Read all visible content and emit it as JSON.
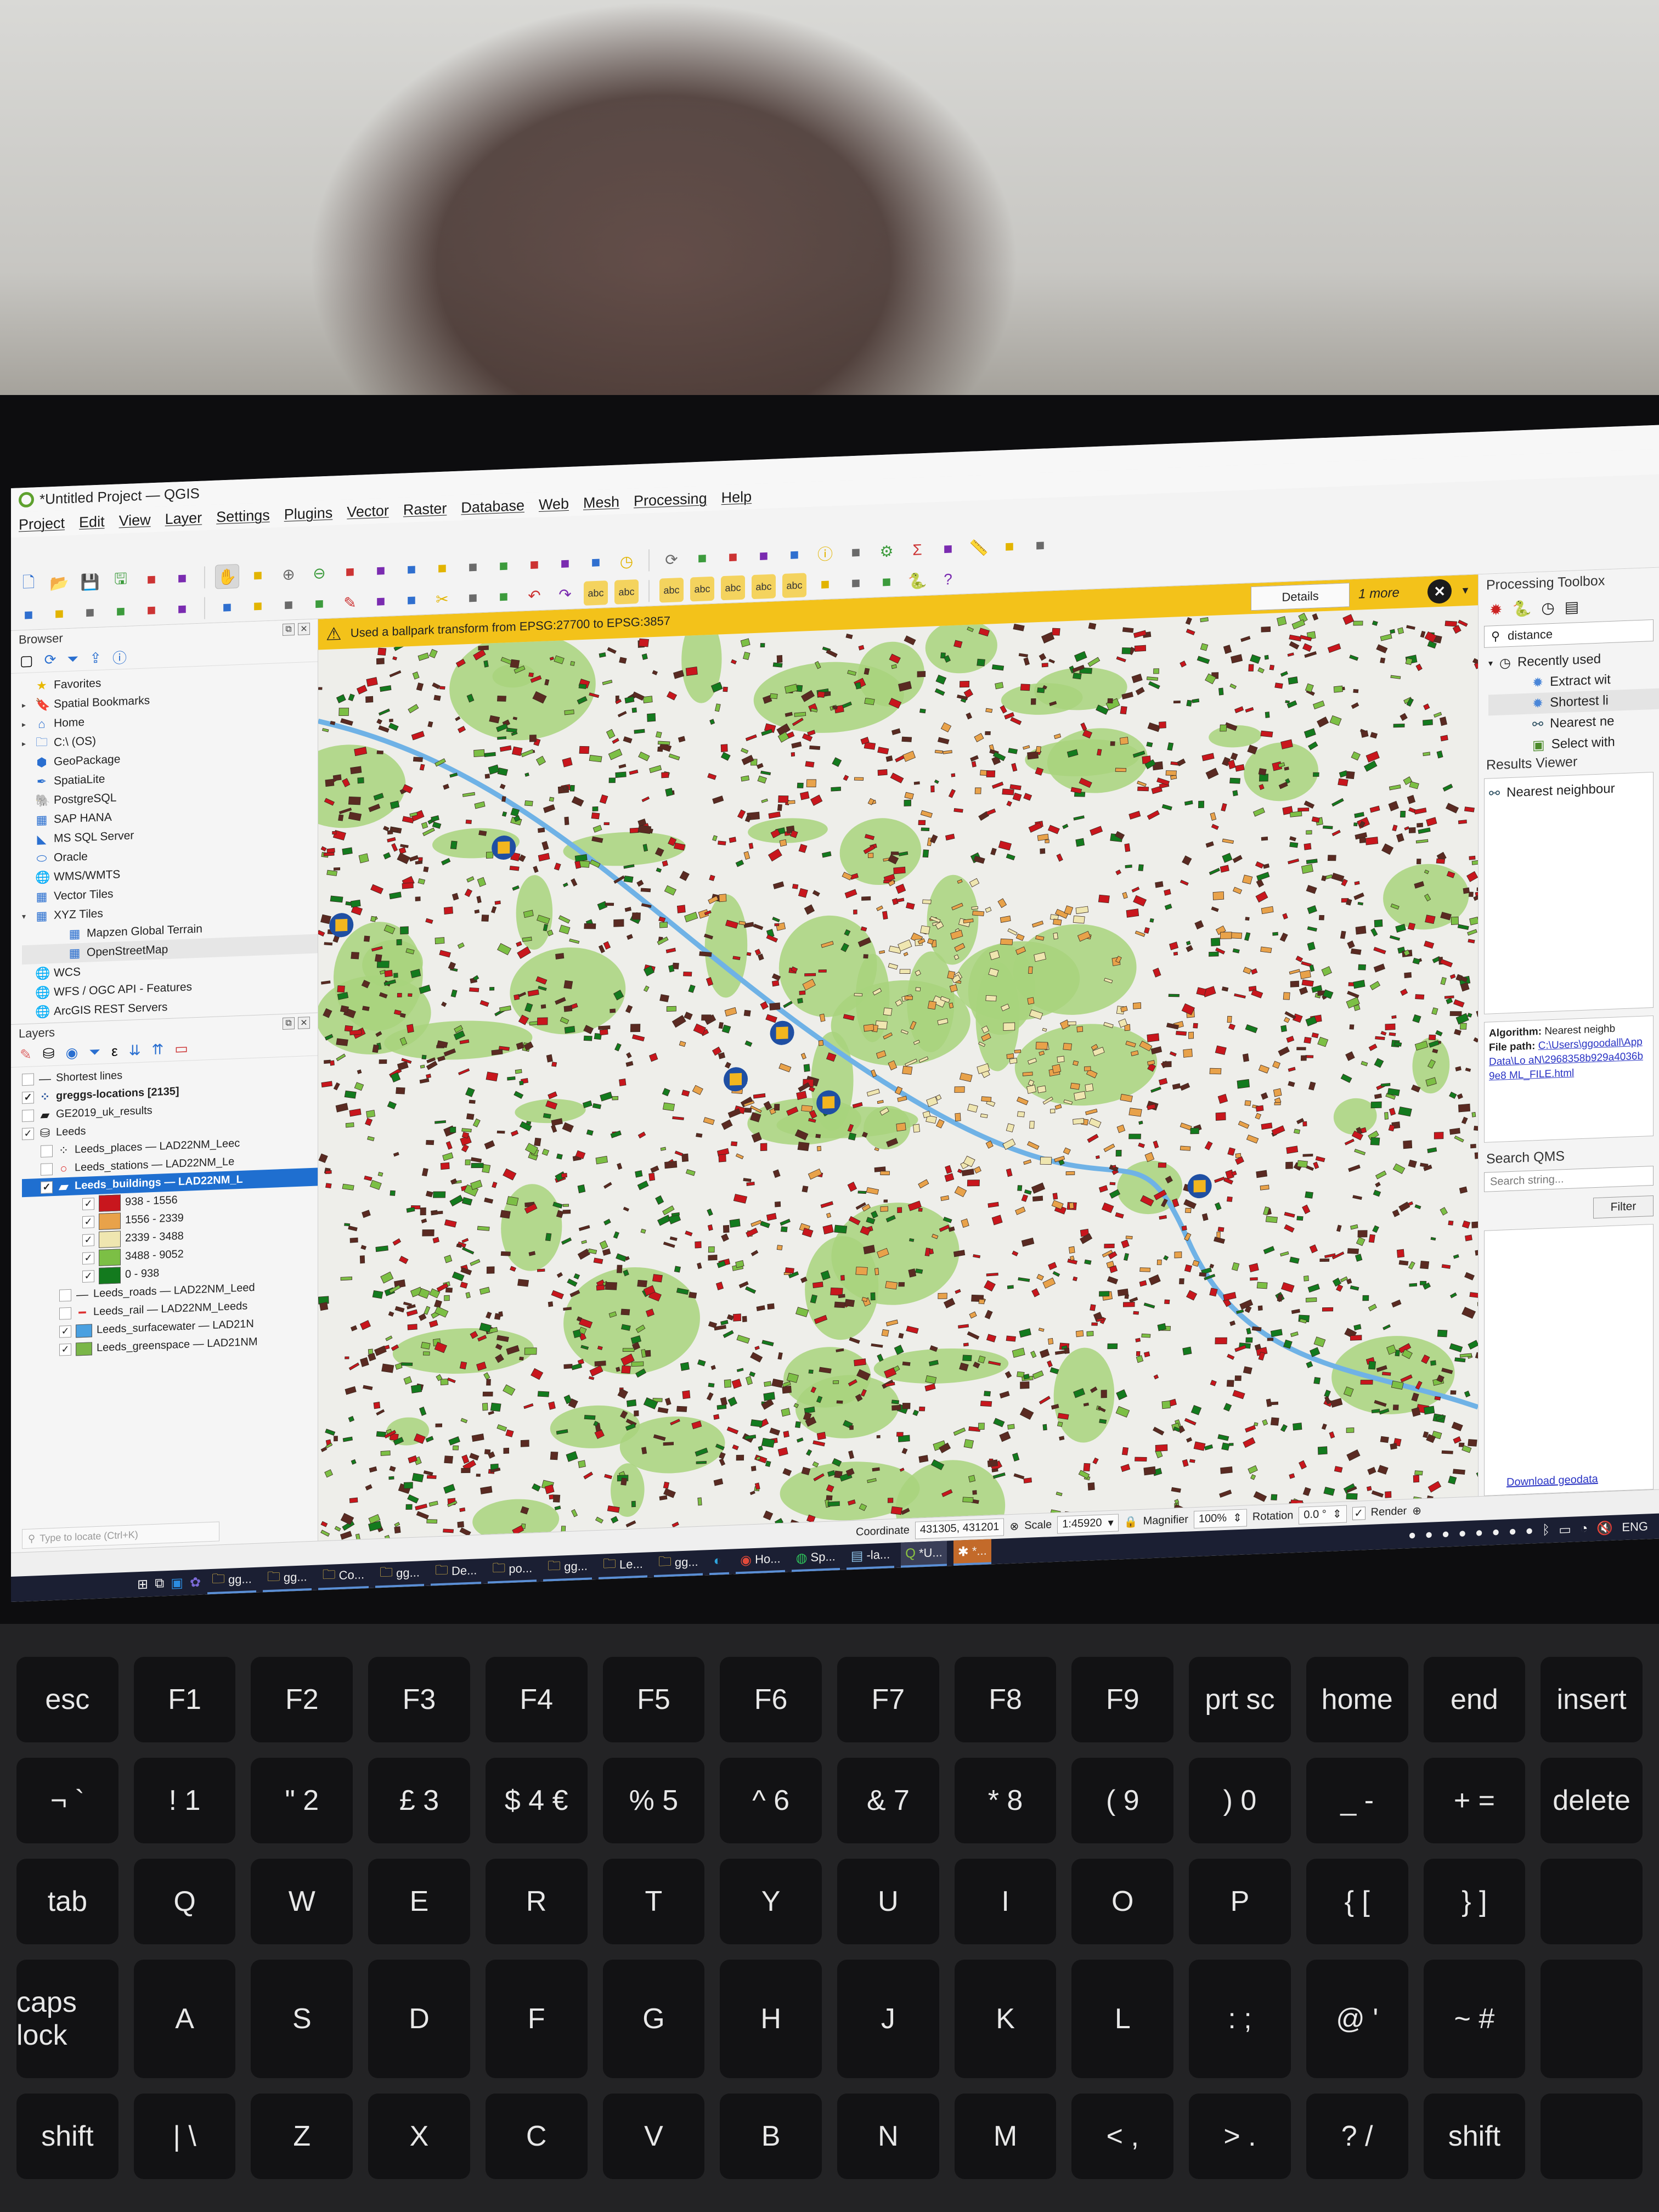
{
  "window": {
    "title": "*Untitled Project — QGIS"
  },
  "menubar": [
    "Project",
    "Edit",
    "View",
    "Layer",
    "Settings",
    "Plugins",
    "Vector",
    "Raster",
    "Database",
    "Web",
    "Mesh",
    "Processing",
    "Help"
  ],
  "toolbar_icons": {
    "row1": [
      "new-project-icon",
      "open-project-icon",
      "save-project-icon",
      "save-as-icon",
      "project-properties-icon",
      "style-manager-icon",
      "pan-icon",
      "pan-to-selection-icon",
      "zoom-in-icon",
      "zoom-out-icon",
      "zoom-full-icon",
      "zoom-to-selection-icon",
      "zoom-to-layer-icon",
      "zoom-native-icon",
      "zoom-last-icon",
      "zoom-next-icon",
      "new-bookmark-icon",
      "show-bookmarks-icon",
      "new-3d-view-icon",
      "temporal-controller-icon",
      "refresh-icon",
      "select-features-icon",
      "select-by-value-icon",
      "deselect-icon",
      "select-location-icon",
      "identify-icon",
      "open-attribute-table-icon",
      "toolbox-icon",
      "statistics-icon",
      "attribute-table-icon",
      "measure-icon",
      "map-tips-icon",
      "locate-icon"
    ],
    "row2": [
      "add-layer-icon",
      "geopackage-icon",
      "vector-layer-icon",
      "spatialite-icon",
      "virtual-layer-icon",
      "mesh-layer-icon",
      "new-shapefile-icon",
      "current-edits-icon",
      "toggle-editing-icon",
      "save-edits-icon",
      "digitize-icon",
      "vertex-tool-icon",
      "delete-selected-icon",
      "cut-icon",
      "copy-icon",
      "paste-icon",
      "undo-icon",
      "redo-icon",
      "label-icon",
      "diagram-icon",
      "pin-label-icon",
      "show-hide-labels-icon",
      "move-label-icon",
      "rotate-label-icon",
      "change-label-icon",
      "quickmapservices-icon",
      "search-qms-icon",
      "geocoder-icon",
      "python-console-icon",
      "help-icon"
    ]
  },
  "message_bar": {
    "text": "Used a ballpark transform from EPSG:27700 to EPSG:3857",
    "details_label": "Details",
    "more_label": "1 more"
  },
  "browser": {
    "title": "Browser",
    "items": [
      {
        "label": "Favorites",
        "icon": "star-icon",
        "arrow": ""
      },
      {
        "label": "Spatial Bookmarks",
        "icon": "bookmark-icon",
        "arrow": "▸"
      },
      {
        "label": "Home",
        "icon": "home-folder-icon",
        "arrow": "▸"
      },
      {
        "label": "C:\\ (OS)",
        "icon": "folder-icon",
        "arrow": "▸"
      },
      {
        "label": "GeoPackage",
        "icon": "geopackage-icon",
        "arrow": ""
      },
      {
        "label": "SpatiaLite",
        "icon": "spatialite-icon",
        "arrow": ""
      },
      {
        "label": "PostgreSQL",
        "icon": "postgresql-icon",
        "arrow": ""
      },
      {
        "label": "SAP HANA",
        "icon": "sap-hana-icon",
        "arrow": ""
      },
      {
        "label": "MS SQL Server",
        "icon": "mssql-icon",
        "arrow": ""
      },
      {
        "label": "Oracle",
        "icon": "oracle-icon",
        "arrow": ""
      },
      {
        "label": "WMS/WMTS",
        "icon": "globe-icon",
        "arrow": ""
      },
      {
        "label": "Vector Tiles",
        "icon": "grid-icon",
        "arrow": ""
      },
      {
        "label": "XYZ Tiles",
        "icon": "grid-icon",
        "arrow": "▾"
      },
      {
        "label": "Mapzen Global Terrain",
        "icon": "grid-icon",
        "arrow": "",
        "child": true
      },
      {
        "label": "OpenStreetMap",
        "icon": "grid-icon",
        "arrow": "",
        "child": true,
        "highlight": true
      },
      {
        "label": "WCS",
        "icon": "globe-icon",
        "arrow": ""
      },
      {
        "label": "WFS / OGC API - Features",
        "icon": "globe-icon",
        "arrow": ""
      },
      {
        "label": "ArcGIS REST Servers",
        "icon": "globe-icon",
        "arrow": ""
      }
    ]
  },
  "layers": {
    "title": "Layers",
    "items": [
      {
        "label": "Shortest lines",
        "checked": false,
        "icon": "line-layer-icon",
        "indent": 0
      },
      {
        "label": "greggs-locations [2135]",
        "checked": true,
        "icon": "point-layer-icon",
        "indent": 0,
        "bold": true
      },
      {
        "label": "GE2019_uk_results",
        "checked": false,
        "icon": "polygon-layer-icon",
        "indent": 0
      },
      {
        "label": "Leeds",
        "checked": true,
        "icon": "group-icon",
        "indent": 0
      },
      {
        "label": "Leeds_places — LAD22NM_Leec",
        "checked": false,
        "icon": "point-layer-icon",
        "indent": 1
      },
      {
        "label": "Leeds_stations — LAD22NM_Le",
        "checked": false,
        "icon": "station-icon",
        "indent": 1
      },
      {
        "label": "Leeds_buildings — LAD22NM_L",
        "checked": true,
        "icon": "polygon-layer-icon",
        "indent": 1,
        "selected": true
      }
    ],
    "legend": [
      {
        "label": "938 - 1556",
        "color": "#c8161d",
        "checked": true
      },
      {
        "label": "1556 - 2339",
        "color": "#e8a24a",
        "checked": true
      },
      {
        "label": "2339 - 3488",
        "color": "#efe6b0",
        "checked": true
      },
      {
        "label": "3488 - 9052",
        "color": "#7cbf45",
        "checked": true
      },
      {
        "label": "0 - 938",
        "color": "#137a1e",
        "checked": true
      }
    ],
    "more_items": [
      {
        "label": "Leeds_roads — LAD22NM_Leed",
        "checked": false,
        "icon": "line-layer-icon"
      },
      {
        "label": "Leeds_rail — LAD22NM_Leeds",
        "checked": false,
        "icon": "rail-line-icon"
      },
      {
        "label": "Leeds_surfacewater — LAD21N",
        "checked": true,
        "swatch": "#4aa0e0"
      },
      {
        "label": "Leeds_greenspace — LAD21NM",
        "checked": true,
        "swatch": "#7ab648"
      }
    ],
    "locator_placeholder": "Type to locate (Ctrl+K)"
  },
  "processing_toolbox": {
    "title": "Processing Toolbox",
    "search_value": "distance",
    "recent_label": "Recently used",
    "items": [
      "Extract wit",
      "Shortest li",
      "Nearest ne",
      "Select with"
    ]
  },
  "results_viewer": {
    "title": "Results Viewer",
    "items": [
      "Nearest neighbour"
    ]
  },
  "algorithm_info": {
    "algorithm_label": "Algorithm:",
    "algorithm_value": "Nearest neighb",
    "filepath_label": "File path:",
    "filepath_value": "C:\\Users\\ggoodall\\AppData\\Lo aN\\2968358b929a4036b9e8 ML_FILE.html"
  },
  "qms": {
    "title": "Search QMS",
    "placeholder": "Search string...",
    "filter_label": "Filter",
    "download_link": "Download geodata"
  },
  "statusbar": {
    "coordinate_label": "Coordinate",
    "coordinate_value": "431305, 431201",
    "scale_label": "Scale",
    "scale_value": "1:45920",
    "magnifier_label": "Magnifier",
    "magnifier_value": "100%",
    "rotation_label": "Rotation",
    "rotation_value": "0.0 °",
    "render_label": "Render",
    "render_checked": true
  },
  "taskbar": {
    "apps": [
      {
        "label": "gg...",
        "icon": "folder-icon"
      },
      {
        "label": "gg...",
        "icon": "folder-icon"
      },
      {
        "label": "Co...",
        "icon": "folder-icon"
      },
      {
        "label": "gg...",
        "icon": "folder-icon"
      },
      {
        "label": "De...",
        "icon": "folder-icon"
      },
      {
        "label": "po...",
        "icon": "folder-icon"
      },
      {
        "label": "gg...",
        "icon": "folder-icon"
      },
      {
        "label": "Le...",
        "icon": "folder-icon"
      },
      {
        "label": "gg...",
        "icon": "folder-icon"
      },
      {
        "label": "",
        "icon": "edge-icon"
      },
      {
        "label": "Ho...",
        "icon": "chrome-icon"
      },
      {
        "label": "Sp...",
        "icon": "spotify-icon"
      },
      {
        "label": "-la...",
        "icon": "notepad-icon"
      },
      {
        "label": "*U...",
        "icon": "qgis-icon",
        "active": true
      },
      {
        "label": "*...",
        "icon": "slack-icon",
        "orange": true
      }
    ],
    "tray_lang": "ENG"
  },
  "map": {
    "colors": {
      "background": "#eeeeea",
      "greenspace": "#a8d47c",
      "water": "#6fb2e6",
      "building_outline": "#3b2a20",
      "class_colors": [
        "#c8161d",
        "#e8a24a",
        "#efe6b0",
        "#7cbf45",
        "#137a1e"
      ]
    },
    "marker_icon": "greggs-marker-icon",
    "markers": 6
  }
}
